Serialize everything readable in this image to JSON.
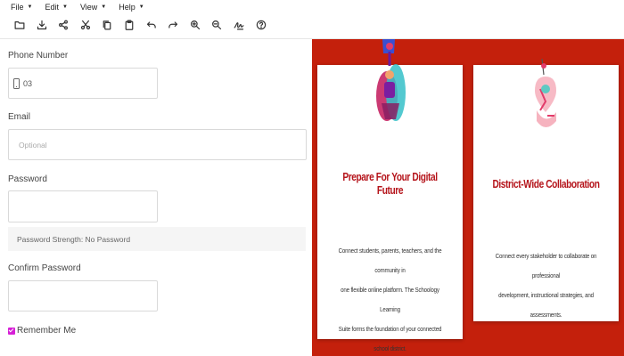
{
  "menu": {
    "items": [
      {
        "label": "File",
        "name": "menu-file"
      },
      {
        "label": "Edit",
        "name": "menu-edit"
      },
      {
        "label": "View",
        "name": "menu-view"
      },
      {
        "label": "Help",
        "name": "menu-help"
      }
    ]
  },
  "toolbar": {
    "icons": [
      "open-folder-icon",
      "download-icon",
      "share-icon",
      "cut-icon",
      "copy-icon",
      "paste-icon",
      "undo-icon",
      "redo-icon",
      "zoom-in-icon",
      "zoom-out-icon",
      "signature-icon",
      "help-icon"
    ]
  },
  "form": {
    "phone_label": "Phone Number",
    "phone_value": "03",
    "email_label": "Email",
    "email_placeholder": "Optional",
    "password_label": "Password",
    "password_strength": "Password Strength: No Password",
    "confirm_label": "Confirm Password",
    "remember_label": "Remember Me",
    "remember_checked": true,
    "accent_color": "#d61fd6"
  },
  "promo": {
    "background_color": "#c4200c",
    "title_color": "#b5141b",
    "cards": [
      {
        "title": "Prepare For Your Digital Future",
        "lines": [
          "Connect students, parents, teachers, and the community in",
          "one flexible online platform. The Schoology Learning",
          "Suite forms the foundation of your connected school district."
        ]
      },
      {
        "title": "District-Wide Collaboration",
        "lines": [
          "Connect every stakeholder to collaborate on professional",
          "development, instructional strategies, and assessments."
        ]
      }
    ]
  }
}
